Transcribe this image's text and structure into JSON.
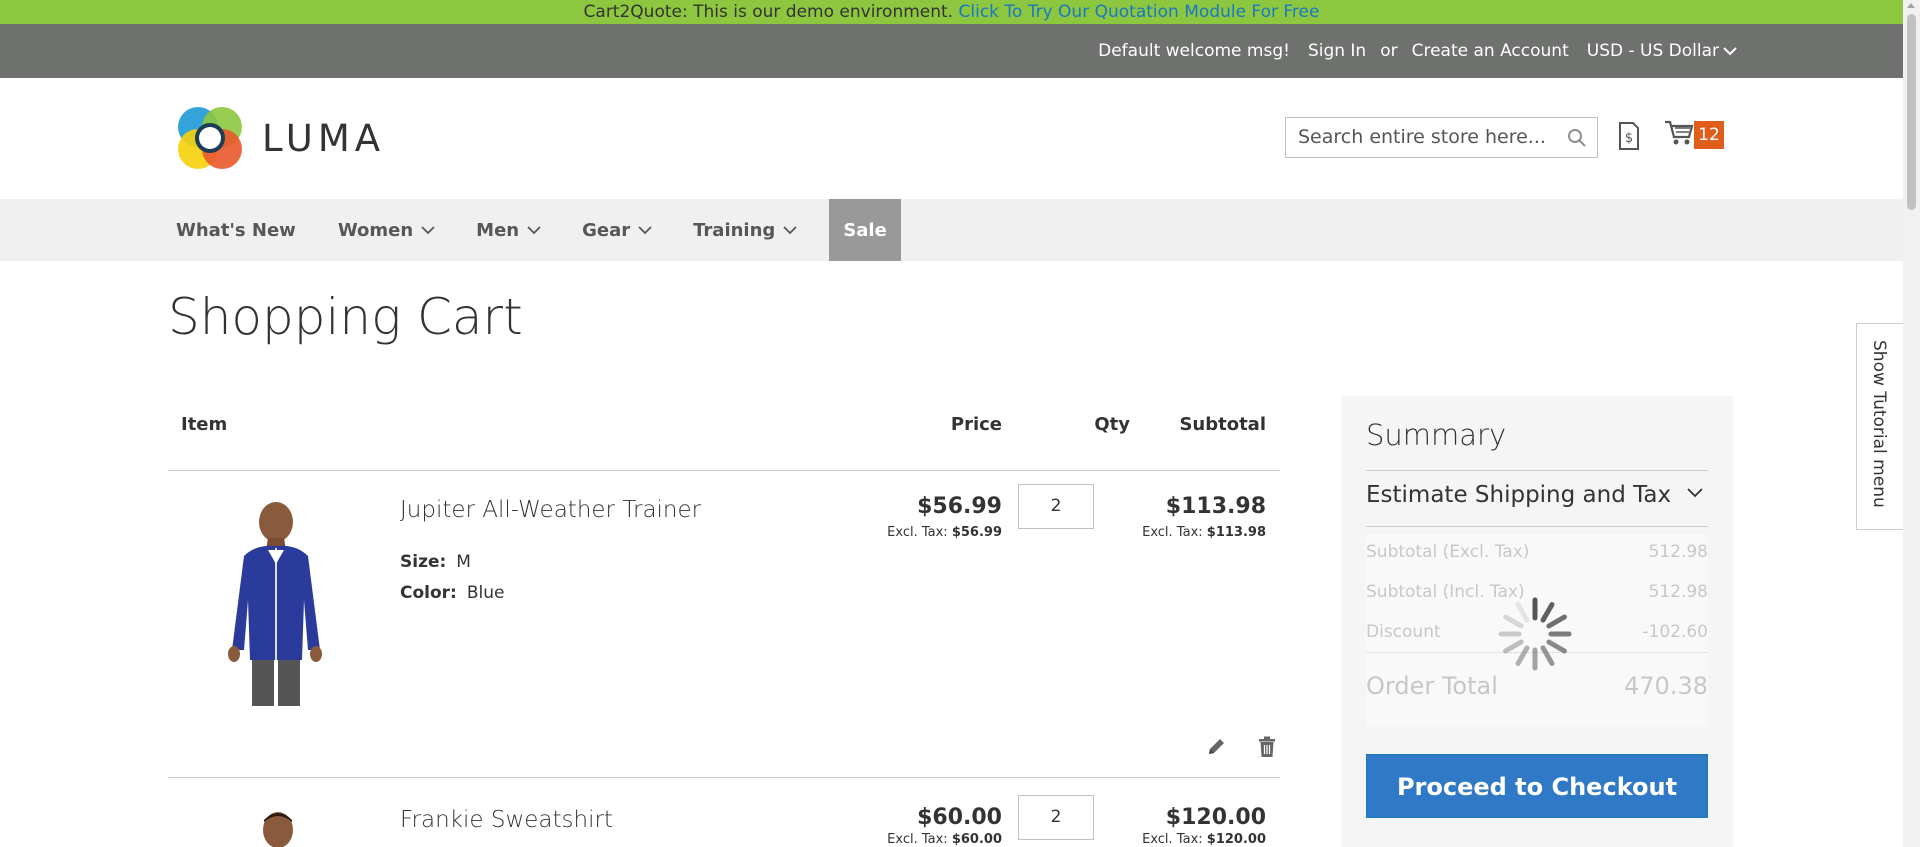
{
  "banner": {
    "text": "Cart2Quote: This is our demo environment. ",
    "link": "Click To Try Our Quotation Module For Free"
  },
  "top_bar": {
    "welcome": "Default welcome msg!",
    "sign_in": "Sign In",
    "or": "or",
    "create_account": "Create an Account",
    "currency": "USD - US Dollar"
  },
  "header": {
    "logo_text": "LUMA",
    "search_placeholder": "Search entire store here...",
    "cart_count": "12"
  },
  "nav": {
    "items": [
      {
        "label": "What's New",
        "has_submenu": false
      },
      {
        "label": "Women",
        "has_submenu": true
      },
      {
        "label": "Men",
        "has_submenu": true
      },
      {
        "label": "Gear",
        "has_submenu": true
      },
      {
        "label": "Training",
        "has_submenu": true
      },
      {
        "label": "Sale",
        "has_submenu": false
      }
    ]
  },
  "page": {
    "title": "Shopping Cart"
  },
  "cart": {
    "headers": {
      "item": "Item",
      "price": "Price",
      "qty": "Qty",
      "subtotal": "Subtotal"
    },
    "excl_label": "Excl. Tax:",
    "items": [
      {
        "name": "Jupiter All-Weather Trainer",
        "options": [
          {
            "label": "Size:",
            "value": "M"
          },
          {
            "label": "Color:",
            "value": "Blue"
          }
        ],
        "price": "$56.99",
        "price_excl": "$56.99",
        "qty": "2",
        "subtotal": "$113.98",
        "subtotal_excl": "$113.98"
      },
      {
        "name": "Frankie Sweatshirt",
        "options": [],
        "price": "$60.00",
        "price_excl": "$60.00",
        "qty": "2",
        "subtotal": "$120.00",
        "subtotal_excl": "$120.00"
      }
    ]
  },
  "summary": {
    "title": "Summary",
    "estimate": "Estimate Shipping and Tax",
    "rows": [
      {
        "label": "Subtotal (Excl. Tax)",
        "value": "512.98"
      },
      {
        "label": "Subtotal (Incl. Tax)",
        "value": "512.98"
      },
      {
        "label": "Discount",
        "value": "-102.60"
      }
    ],
    "order_total_label": "Order Total",
    "order_total_value": "470.38",
    "checkout": "Proceed to Checkout"
  },
  "tutorial": {
    "label": "Show Tutorial menu"
  },
  "colors": {
    "banner_bg": "#8dc63f",
    "topbar_bg": "#6e716e",
    "link": "#1979c3",
    "cart_badge": "#e15d1b",
    "checkout_btn": "#2f79c7",
    "nav_bg": "#f0f0f0",
    "sale_bg": "#999999"
  }
}
